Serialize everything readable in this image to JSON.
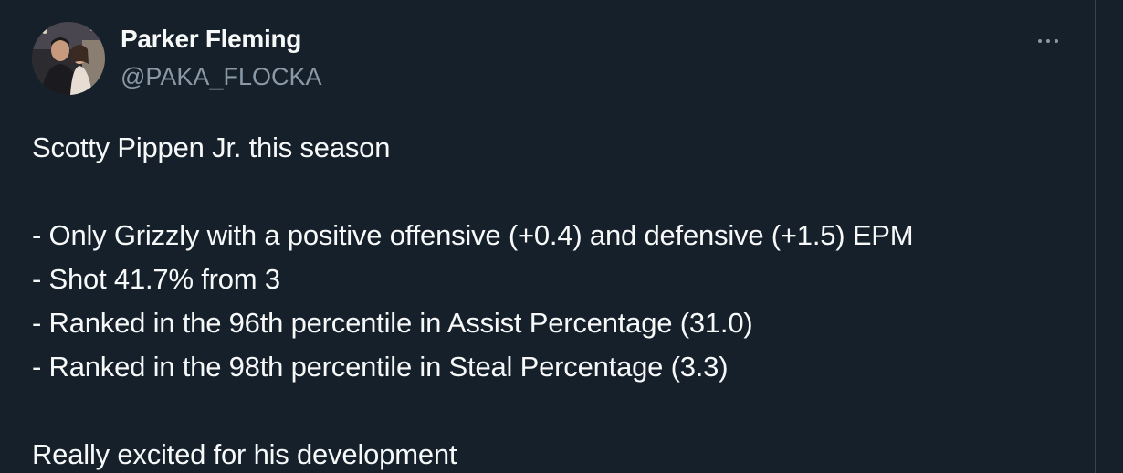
{
  "author": {
    "display_name": "Parker Fleming",
    "handle": "@PAKA_FLOCKA"
  },
  "more_icon": "more-horizontal-icon",
  "tweet": {
    "lines": [
      "Scotty Pippen Jr. this season",
      "",
      "- Only Grizzly with a positive offensive (+0.4) and defensive (+1.5) EPM",
      "- Shot 41.7% from 3",
      "- Ranked in the 96th percentile in Assist Percentage (31.0)",
      "- Ranked in the 98th percentile in Steal Percentage (3.3)",
      "",
      "Really excited for his development"
    ]
  },
  "colors": {
    "background": "#15202b",
    "text_primary": "#f7f9f9",
    "text_secondary": "#8b98a5",
    "border": "#38444d"
  }
}
